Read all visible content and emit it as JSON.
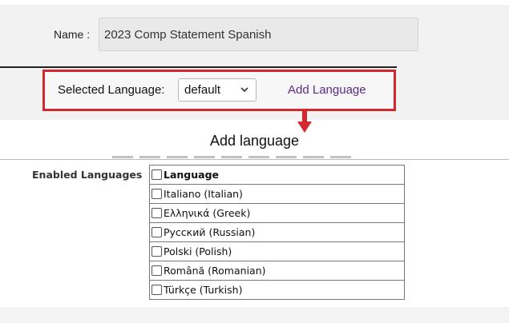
{
  "form": {
    "name_label": "Name :",
    "name_value": "2023 Comp Statement Spanish",
    "selected_language_label": "Selected Language:",
    "selected_language_value": "default",
    "add_language_link": "Add Language"
  },
  "dialog": {
    "title": "Add language",
    "enabled_languages_label": "Enabled Languages",
    "table_header": "Language",
    "languages": [
      "Italiano (Italian)",
      "Ελληνικά (Greek)",
      "Русский (Russian)",
      "Polski (Polish)",
      "Română (Romanian)",
      "Türkçe (Turkish)"
    ]
  },
  "colors": {
    "highlight": "#d3292e",
    "link": "#5b2a86"
  }
}
